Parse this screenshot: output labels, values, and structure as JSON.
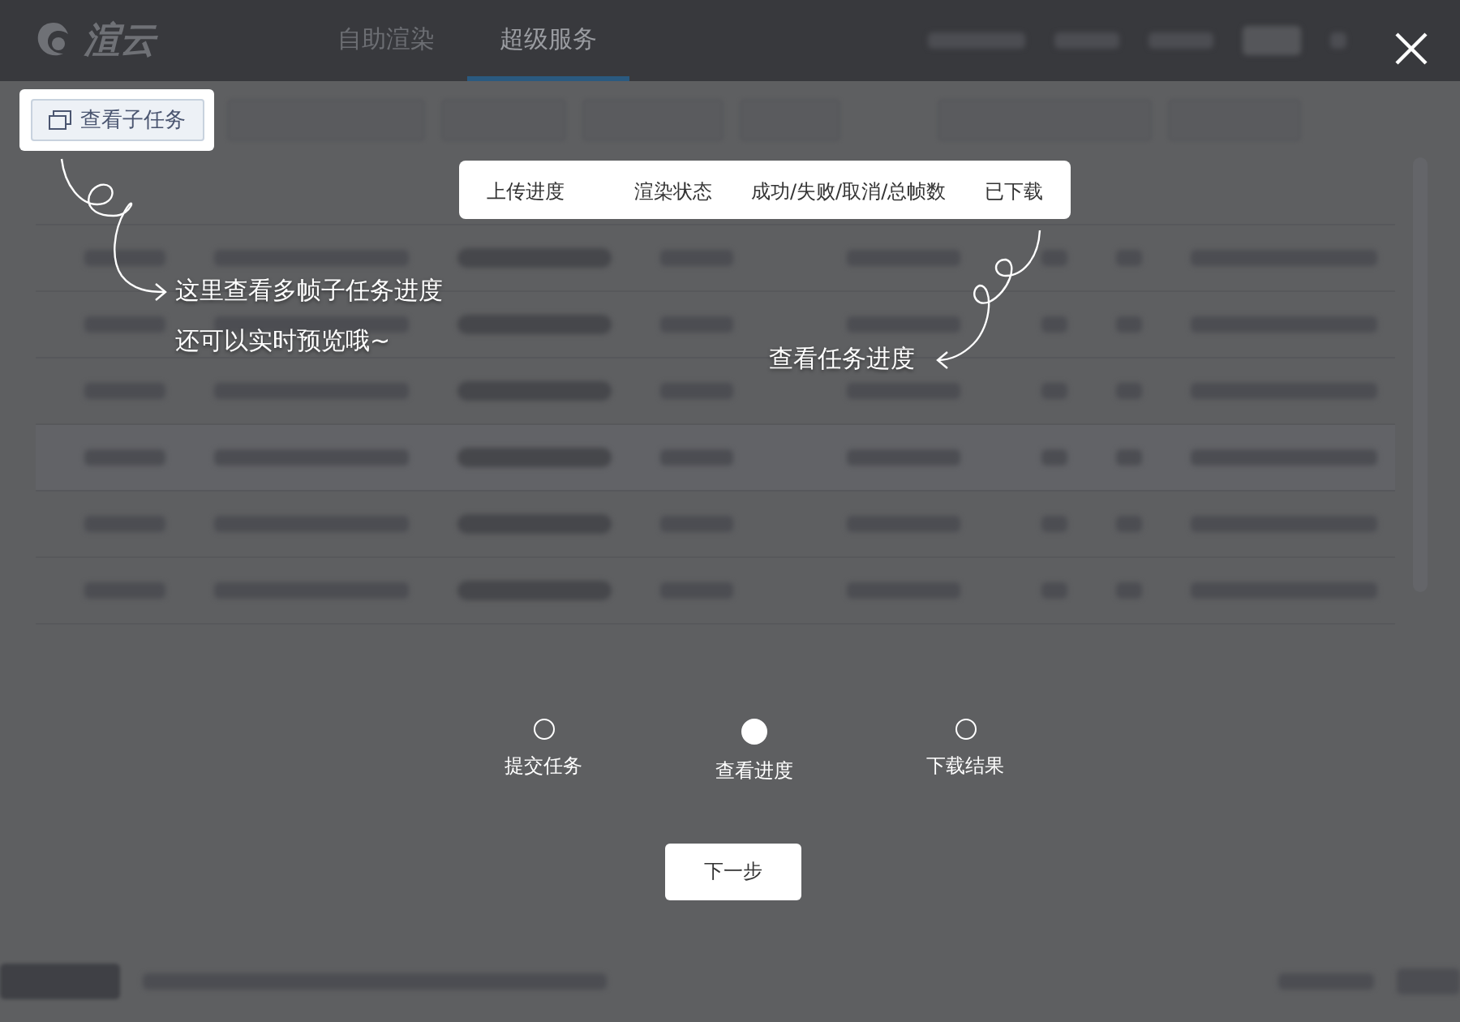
{
  "app_header": {
    "logo": "渲云",
    "tabs": [
      {
        "label": "自助渲染",
        "selected": false
      },
      {
        "label": "超级服务",
        "selected": true
      }
    ]
  },
  "highlight_button": {
    "label": "查看子任务"
  },
  "column_callout": {
    "columns": [
      "上传进度",
      "渲染状态",
      "成功/失败/取消/总帧数",
      "已下载"
    ]
  },
  "hint_left": {
    "lines": [
      "这里查看多帧子任务进度",
      "还可以实时预览哦~"
    ]
  },
  "hint_right": {
    "text": "查看任务进度"
  },
  "steps": [
    {
      "label": "提交任务",
      "selected": false
    },
    {
      "label": "查看进度",
      "selected": true
    },
    {
      "label": "下载结果",
      "selected": false
    }
  ],
  "next_button": {
    "label": "下一步"
  }
}
